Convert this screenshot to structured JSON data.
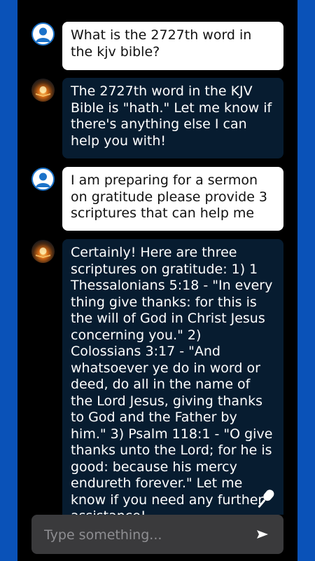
{
  "conversation": {
    "messages": [
      {
        "role": "user",
        "text": "What is the 2727th word in the kjv bible?"
      },
      {
        "role": "bot",
        "text": "The 2727th word in the KJV Bible is \"hath.\" Let me know if there's anything else I can help you with!"
      },
      {
        "role": "user",
        "text": "I am preparing for a sermon on gratitude please provide 3 scriptures that can help me"
      },
      {
        "role": "bot",
        "text": "Certainly! Here are three scriptures on gratitude: 1) 1 Thessalonians 5:18 - \"In every thing give thanks: for this is the will of God in Christ Jesus concerning you.\" 2) Colossians 3:17 - \"And whatsoever ye do in word or deed, do all in the name of the Lord Jesus, giving thanks to God and the Father by him.\" 3) Psalm 118:1 - \"O give thanks unto the Lord; for he is good: because his mercy endureth forever.\" Let me know if you need any further assistance!"
      }
    ]
  },
  "composer": {
    "placeholder": "Type something...",
    "send_icon": "send-icon",
    "mic_icon": "microphone-icon"
  },
  "colors": {
    "side_bar": "#0a52b8",
    "bot_bubble": "#071c30",
    "user_bubble": "#ffffff"
  }
}
